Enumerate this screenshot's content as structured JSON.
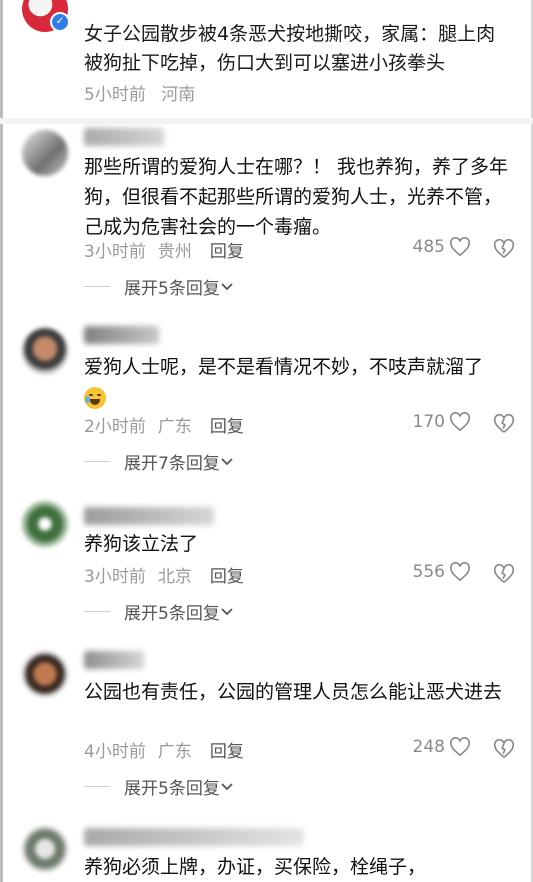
{
  "post": {
    "text": "女子公园散步被4条恶犬按地撕咬，家属：腿上肉被狗扯下吃掉，伤口大到可以塞进小孩拳头",
    "time": "5小时前",
    "location": "河南"
  },
  "comments": [
    {
      "text": "那些所谓的爱狗人士在哪？！ 我也养狗，养了多年狗，但很看不起那些所谓的爱狗人士，光养不管，己成为危害社会的一个毒瘤。",
      "time": "3小时前",
      "location": "贵州",
      "reply": "回复",
      "likes": "485",
      "expand": "展开5条回复"
    },
    {
      "text": "爱狗人士呢，是不是看情况不妙，不吱声就溜了",
      "time": "2小时前",
      "location": "广东",
      "reply": "回复",
      "likes": "170",
      "expand": "展开7条回复"
    },
    {
      "text": "养狗该立法了",
      "time": "3小时前",
      "location": "北京",
      "reply": "回复",
      "likes": "556",
      "expand": "展开5条回复"
    },
    {
      "text": "公园也有责任，公园的管理人员怎么能让恶犬进去",
      "time": "4小时前",
      "location": "广东",
      "reply": "回复",
      "likes": "248",
      "expand": "展开5条回复"
    },
    {
      "text": "养狗必须上牌，办证，买保险，栓绳子，",
      "time": "",
      "location": "",
      "reply": "",
      "likes": "",
      "expand": ""
    }
  ],
  "icons": {
    "like": "heart-outline-icon",
    "dislike": "broken-heart-icon",
    "expand": "chevron-down-icon",
    "verified": "verified-badge-icon",
    "emoji": "crying-laughing-emoji-icon"
  }
}
